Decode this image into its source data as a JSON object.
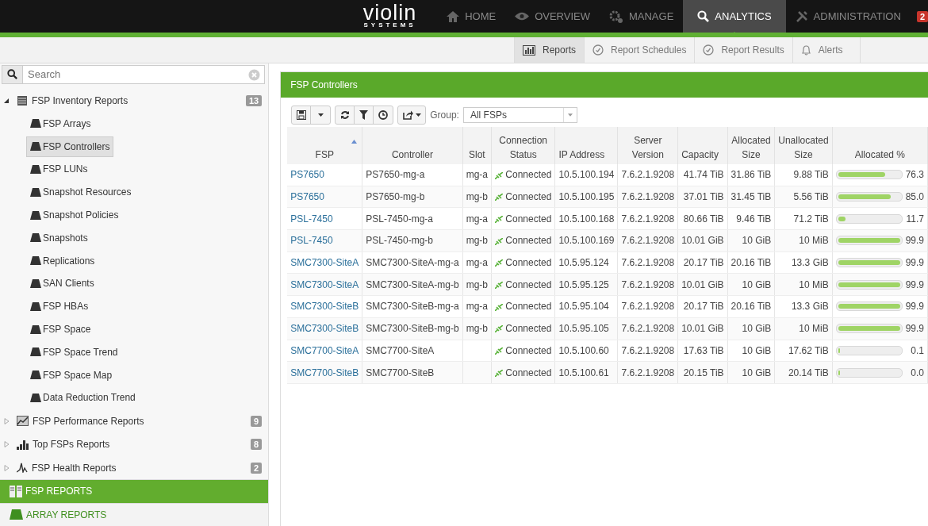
{
  "logo": {
    "name": "violin",
    "sub": "SYSTEMS"
  },
  "nav": [
    {
      "label": "HOME",
      "selected": false
    },
    {
      "label": "OVERVIEW",
      "selected": false
    },
    {
      "label": "MANAGE",
      "selected": false
    },
    {
      "label": "ANALYTICS",
      "selected": true
    },
    {
      "label": "ADMINISTRATION",
      "selected": false
    }
  ],
  "alert_badge": "2",
  "tabs": [
    {
      "label": "Reports",
      "selected": true
    },
    {
      "label": "Report Schedules",
      "selected": false
    },
    {
      "label": "Report Results",
      "selected": false
    },
    {
      "label": "Alerts",
      "selected": false
    }
  ],
  "sidebar": {
    "search": {
      "placeholder": "Search"
    },
    "groups": [
      {
        "label": "FSP Inventory Reports",
        "count": "13",
        "expanded": true,
        "children": [
          {
            "label": "FSP Arrays",
            "selected": false
          },
          {
            "label": "FSP Controllers",
            "selected": true
          },
          {
            "label": "FSP LUNs",
            "selected": false
          },
          {
            "label": "Snapshot Resources",
            "selected": false
          },
          {
            "label": "Snapshot Policies",
            "selected": false
          },
          {
            "label": "Snapshots",
            "selected": false
          },
          {
            "label": "Replications",
            "selected": false
          },
          {
            "label": "SAN Clients",
            "selected": false
          },
          {
            "label": "FSP HBAs",
            "selected": false
          },
          {
            "label": "FSP Space",
            "selected": false
          },
          {
            "label": "FSP Space Trend",
            "selected": false
          },
          {
            "label": "FSP Space Map",
            "selected": false
          },
          {
            "label": "Data Reduction Trend",
            "selected": false
          }
        ]
      },
      {
        "label": "FSP Performance Reports",
        "count": "9",
        "expanded": false
      },
      {
        "label": "Top FSPs Reports",
        "count": "8",
        "expanded": false
      },
      {
        "label": "FSP Health Reports",
        "count": "2",
        "expanded": false
      }
    ],
    "sections": [
      {
        "label": "FSP REPORTS",
        "selected": true
      },
      {
        "label": "ARRAY REPORTS",
        "selected": false
      }
    ]
  },
  "panel": {
    "title": "FSP Controllers",
    "group_label": "Group:",
    "group_value": "All FSPs"
  },
  "table": {
    "columns": [
      {
        "label": "FSP",
        "sorted": true
      },
      {
        "label": "Controller",
        "sorted": false
      },
      {
        "label": "Slot",
        "sorted": false
      },
      {
        "label": "Connection Status",
        "sorted": false
      },
      {
        "label": "IP Address",
        "sorted": false
      },
      {
        "label": "Server Version",
        "sorted": false
      },
      {
        "label": "Capacity",
        "sorted": false
      },
      {
        "label": "Allocated Size",
        "sorted": false
      },
      {
        "label": "Unallocated Size",
        "sorted": false
      },
      {
        "label": "Allocated %",
        "sorted": false
      }
    ],
    "rows": [
      {
        "fsp": "PS7650",
        "controller": "PS7650-mg-a",
        "slot": "mg-a",
        "status": "Connected",
        "ip": "10.5.100.194",
        "version": "7.6.2.1.9208",
        "capacity": "41.74 TiB",
        "allocated": "31.86 TiB",
        "unallocated": "9.88 TiB",
        "level": 0.763,
        "percent": "76.3"
      },
      {
        "fsp": "PS7650",
        "controller": "PS7650-mg-b",
        "slot": "mg-b",
        "status": "Connected",
        "ip": "10.5.100.195",
        "version": "7.6.2.1.9208",
        "capacity": "37.01 TiB",
        "allocated": "31.45 TiB",
        "unallocated": "5.56 TiB",
        "level": 0.85,
        "percent": "85.0"
      },
      {
        "fsp": "PSL-7450",
        "controller": "PSL-7450-mg-a",
        "slot": "mg-a",
        "status": "Connected",
        "ip": "10.5.100.168",
        "version": "7.6.2.1.9208",
        "capacity": "80.66 TiB",
        "allocated": "9.46 TiB",
        "unallocated": "71.2 TiB",
        "level": 0.117,
        "percent": "11.7"
      },
      {
        "fsp": "PSL-7450",
        "controller": "PSL-7450-mg-b",
        "slot": "mg-b",
        "status": "Connected",
        "ip": "10.5.100.169",
        "version": "7.6.2.1.9208",
        "capacity": "10.01 GiB",
        "allocated": "10 GiB",
        "unallocated": "10 MiB",
        "level": 0.999,
        "percent": "99.9"
      },
      {
        "fsp": "SMC7300-SiteA",
        "controller": "SMC7300-SiteA-mg-a",
        "slot": "mg-a",
        "status": "Connected",
        "ip": "10.5.95.124",
        "version": "7.6.2.1.9208",
        "capacity": "20.17 TiB",
        "allocated": "20.16 TiB",
        "unallocated": "13.3 GiB",
        "level": 0.999,
        "percent": "99.9"
      },
      {
        "fsp": "SMC7300-SiteA",
        "controller": "SMC7300-SiteA-mg-b",
        "slot": "mg-b",
        "status": "Connected",
        "ip": "10.5.95.125",
        "version": "7.6.2.1.9208",
        "capacity": "10.01 GiB",
        "allocated": "10 GiB",
        "unallocated": "10 MiB",
        "level": 0.999,
        "percent": "99.9"
      },
      {
        "fsp": "SMC7300-SiteB",
        "controller": "SMC7300-SiteB-mg-a",
        "slot": "mg-a",
        "status": "Connected",
        "ip": "10.5.95.104",
        "version": "7.6.2.1.9208",
        "capacity": "20.17 TiB",
        "allocated": "20.16 TiB",
        "unallocated": "13.3 GiB",
        "level": 0.999,
        "percent": "99.9"
      },
      {
        "fsp": "SMC7300-SiteB",
        "controller": "SMC7300-SiteB-mg-b",
        "slot": "mg-b",
        "status": "Connected",
        "ip": "10.5.95.105",
        "version": "7.6.2.1.9208",
        "capacity": "10.01 GiB",
        "allocated": "10 GiB",
        "unallocated": "10 MiB",
        "level": 0.999,
        "percent": "99.9"
      },
      {
        "fsp": "SMC7700-SiteA",
        "controller": "SMC7700-SiteA",
        "status": "Connected",
        "ip": "10.5.100.60",
        "version": "7.6.2.1.9208",
        "capacity": "17.63 TiB",
        "allocated": "10 GiB",
        "unallocated": "17.62 TiB",
        "level": 0.001,
        "percent": "0.1"
      },
      {
        "fsp": "SMC7700-SiteB",
        "controller": "SMC7700-SiteB",
        "status": "Connected",
        "ip": "10.5.100.61",
        "version": "7.6.2.1.9208",
        "capacity": "20.15 TiB",
        "allocated": "10 GiB",
        "unallocated": "20.14 TiB",
        "level": 0.0,
        "percent": "0.0"
      }
    ]
  }
}
